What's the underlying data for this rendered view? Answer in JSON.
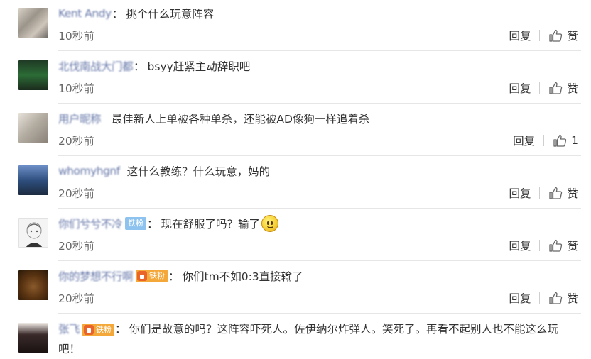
{
  "comments": [
    {
      "username": "Kent Andy",
      "text": "挑个什么玩意阵容",
      "time": "10秒前",
      "reply": "回复",
      "like": "赞",
      "avatar": "grey-blurred-photo"
    },
    {
      "username": "北伐南战大门都",
      "text": "bsyy赶紧主动辞职吧",
      "time": "10秒前",
      "reply": "回复",
      "like": "赞",
      "avatar": "green-stadium-photo"
    },
    {
      "username": "用户昵称",
      "text": "最佳新人上单被各种单杀，还能被AD像狗一样追着杀",
      "time": "20秒前",
      "reply": "回复",
      "like": "1",
      "avatar": "grey-pet-photo"
    },
    {
      "username": "whomyhgnf",
      "text": "这什么教练？什么玩意，妈的",
      "time": "20秒前",
      "reply": "回复",
      "like": "赞",
      "avatar": "blue-landscape-photo"
    },
    {
      "username": "你们兮兮不冷",
      "badge": "铁粉",
      "text": "现在舒服了吗？输了",
      "time": "20秒前",
      "reply": "回复",
      "like": "赞",
      "avatar": "sketch-girl-avatar"
    },
    {
      "username": "你的梦想不行啊",
      "badge": "铁粉",
      "text": "你们tm不如0:3直接输了",
      "time": "20秒前",
      "reply": "回复",
      "like": "赞",
      "avatar": "brown-dog-photo"
    },
    {
      "username": "张飞",
      "badge": "铁粉",
      "text": "你们是故意的吗？这阵容吓死人。佐伊纳尔炸弹人。笑死了。再看不起别人也不能这么玩吧！",
      "avatar": "dark-hair-person-photo"
    }
  ],
  "colors": {
    "username": "#4a5f9a",
    "text": "#333333",
    "meta": "#666666",
    "badge_blue": "#8dc3ee",
    "badge_orange": "#f4a83a",
    "divider": "#e6e6e6"
  }
}
